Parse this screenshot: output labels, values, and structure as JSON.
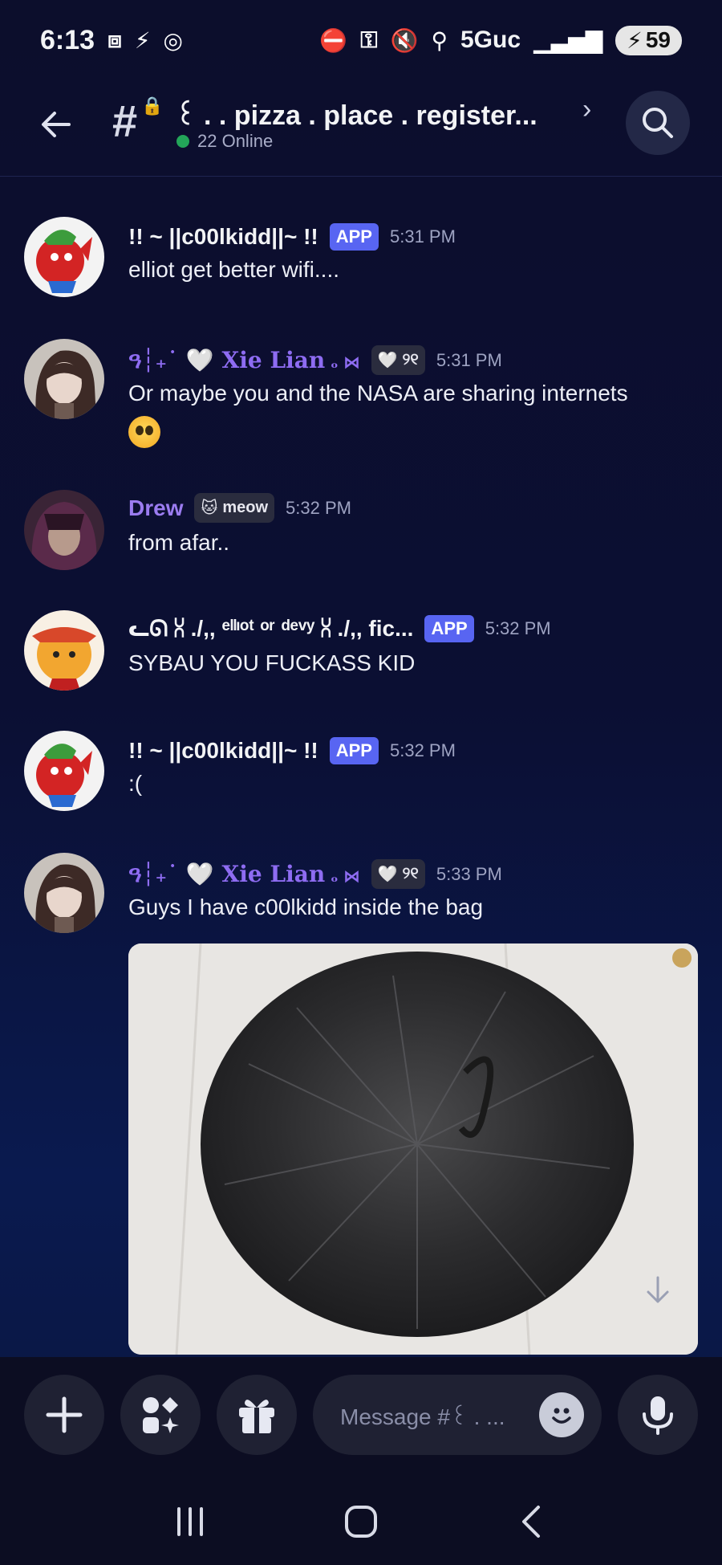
{
  "status_bar": {
    "time": "6:13",
    "network": "5Guc",
    "battery": "59"
  },
  "header": {
    "channel_name": "꒰ .  . pizza . place . register...",
    "online_count": "22 Online"
  },
  "messages": [
    {
      "username": "!! ~ ||c00lkidd||~ !!",
      "badge": "APP",
      "time": "5:31 PM",
      "text": "elliot get better wifi...."
    },
    {
      "username_prefix": "ዓ┆₊˙ ",
      "username": "Xie Lian",
      "username_suffix": " ₒ ⋈",
      "tag": "୨୧",
      "time": "5:31 PM",
      "text_line1": "Or maybe you and the NASA are sharing internets",
      "emoji": "pleading-face"
    },
    {
      "username": "Drew",
      "tag": "meow",
      "time": "5:32 PM",
      "text": "from afar.."
    },
    {
      "username": "ᓚᘏ ⩆ ./,, ᵉˡˡᶦᵒᵗ   ᵒʳ   ᵈᵉᵛʸ  ⩆ ./,, fic...",
      "badge": "APP",
      "time": "5:32 PM",
      "text": "SYBAU YOU FUCKASS KID"
    },
    {
      "username": "!! ~ ||c00lkidd||~ !!",
      "badge": "APP",
      "time": "5:32 PM",
      "text": ":("
    },
    {
      "username_prefix": "ዓ┆₊˙ ",
      "username": "Xie Lian",
      "username_suffix": " ₒ ⋈",
      "tag": "୨୧",
      "time": "5:33 PM",
      "text": "Guys I have c00lkidd inside the bag"
    }
  ],
  "composer": {
    "placeholder": "Message #꒰ . ..."
  },
  "colors": {
    "accent": "#5865f2",
    "online": "#23a559",
    "username_purple": "#8e6cf2"
  }
}
